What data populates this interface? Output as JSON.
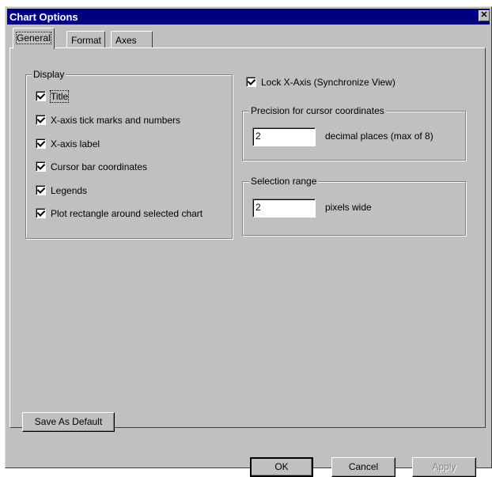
{
  "window": {
    "title": "Chart Options",
    "close_glyph": "✕"
  },
  "tabs": [
    {
      "label": "General",
      "active": true
    },
    {
      "label": "Format",
      "active": false
    },
    {
      "label": "Axes",
      "active": false
    }
  ],
  "display_group": {
    "legend": "Display",
    "items": [
      {
        "label": "Title",
        "checked": true
      },
      {
        "label": "X-axis tick marks and numbers",
        "checked": true
      },
      {
        "label": "X-axis label",
        "checked": true
      },
      {
        "label": "Cursor bar coordinates",
        "checked": true
      },
      {
        "label": "Legends",
        "checked": true
      },
      {
        "label": "Plot rectangle around selected chart",
        "checked": true
      }
    ]
  },
  "lock_x_axis": {
    "label": "Lock X-Axis (Synchronize View)",
    "checked": true
  },
  "precision_group": {
    "legend": "Precision for cursor coordinates",
    "value": "2",
    "suffix": "decimal places (max of 8)"
  },
  "selection_group": {
    "legend": "Selection range",
    "value": "2",
    "suffix": "pixels wide"
  },
  "buttons": {
    "save_default": "Save As Default",
    "ok": "OK",
    "cancel": "Cancel",
    "apply": "Apply"
  }
}
